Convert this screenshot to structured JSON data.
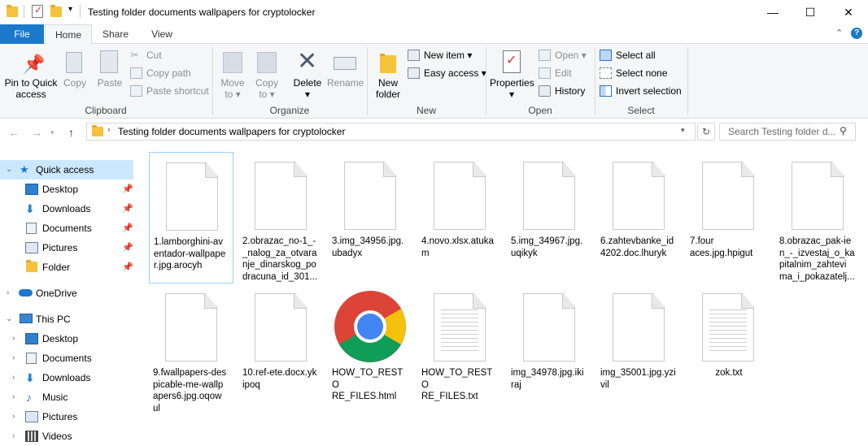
{
  "window": {
    "title": "Testing folder documents  wallpapers for cryptolocker",
    "minimize": "—",
    "maximize": "☐",
    "close": "✕"
  },
  "tabs": {
    "file": "File",
    "home": "Home",
    "share": "Share",
    "view": "View"
  },
  "ribbon": {
    "clipboard": {
      "label": "Clipboard",
      "pin": "Pin to Quick access",
      "pin_line1": "Pin to Quick",
      "pin_line2": "access",
      "copy": "Copy",
      "paste": "Paste",
      "cut": "Cut",
      "copy_path": "Copy path",
      "paste_shortcut": "Paste shortcut"
    },
    "organize": {
      "label": "Organize",
      "move_to": "Move",
      "move_to2": "to ▾",
      "copy_to": "Copy",
      "copy_to2": "to ▾",
      "delete": "Delete",
      "delete2": "▾",
      "rename": "Rename"
    },
    "new": {
      "label": "New",
      "new_folder": "New",
      "new_folder2": "folder",
      "new_item": "New item ▾",
      "easy_access": "Easy access ▾"
    },
    "open": {
      "label": "Open",
      "properties": "Properties",
      "properties2": "▾",
      "open": "Open ▾",
      "edit": "Edit",
      "history": "History"
    },
    "select": {
      "label": "Select",
      "select_all": "Select all",
      "select_none": "Select none",
      "invert": "Invert selection"
    }
  },
  "address": {
    "path": "Testing folder documents  wallpapers for cryptolocker",
    "search_placeholder": "Search Testing folder d..."
  },
  "nav": {
    "quick_access": "Quick access",
    "qa_items": [
      "Desktop",
      "Downloads",
      "Documents",
      "Pictures",
      "Folder"
    ],
    "onedrive": "OneDrive",
    "this_pc": "This PC",
    "pc_items": [
      "Desktop",
      "Documents",
      "Downloads",
      "Music",
      "Pictures",
      "Videos"
    ]
  },
  "files": [
    {
      "name": "1.lamborghini-aventador-wallpaper.jpg.arocyh",
      "icon": "blank-doc"
    },
    {
      "name": "2.obrazac_no-1_-_nalog_za_otvaranje_dinarskog_podracuna_id_301...",
      "icon": "blank-doc"
    },
    {
      "name": "3.img_34956.jpg.ubadyx",
      "icon": "blank-doc"
    },
    {
      "name": "4.novo.xlsx.atukam",
      "icon": "blank-doc"
    },
    {
      "name": "5.img_34967.jpg.uqikyk",
      "icon": "blank-doc"
    },
    {
      "name": "6.zahtevbanke_id4202.doc.lhuryk",
      "icon": "blank-doc"
    },
    {
      "name": "7.four aces.jpg.hpigut",
      "icon": "blank-doc"
    },
    {
      "name": "8.obrazac_pak-ien_-_izvestaj_o_kapitalnim_zahtevima_i_pokazatelj...",
      "icon": "blank-doc"
    },
    {
      "name": "9.fwallpapers-despicable-me-wallpapers6.jpg.oqowul",
      "icon": "blank-doc"
    },
    {
      "name": "10.ref-ete.docx.ykipoq",
      "icon": "blank-doc"
    },
    {
      "name": "HOW_TO_RESTORE_FILES.html",
      "icon": "chrome-icon"
    },
    {
      "name": "HOW_TO_RESTORE_FILES.txt",
      "icon": "text-doc"
    },
    {
      "name": "img_34978.jpg.ikiraj",
      "icon": "blank-doc"
    },
    {
      "name": "img_35001.jpg.yzivil",
      "icon": "blank-doc"
    },
    {
      "name": "zok.txt",
      "icon": "text-doc"
    }
  ],
  "file_display": [
    [
      "1.lamborghini-av",
      "entador-wallpape",
      "r.jpg.arocyh"
    ],
    [
      "2.obrazac_no-1_-",
      "_nalog_za_otvara",
      "nje_dinarskog_po",
      "dracuna_id_301..."
    ],
    [
      "3.img_34956.jpg.",
      "ubadyx"
    ],
    [
      "4.novo.xlsx.atuka",
      "m"
    ],
    [
      "5.img_34967.jpg.",
      "uqikyk"
    ],
    [
      "6.zahtevbanke_id",
      "4202.doc.lhuryk"
    ],
    [
      "7.four",
      "aces.jpg.hpigut"
    ],
    [
      "8.obrazac_pak-ie",
      "n_-_izvestaj_o_ka",
      "pitalnim_zahtevi",
      "ma_i_pokazatelj..."
    ],
    [
      "9.fwallpapers-des",
      "picable-me-wallp",
      "apers6.jpg.oqow",
      "ul"
    ],
    [
      "10.ref-ete.docx.yk",
      "ipoq"
    ],
    [
      "HOW_TO_RESTO",
      "RE_FILES.html"
    ],
    [
      "HOW_TO_RESTO",
      "RE_FILES.txt"
    ],
    [
      "img_34978.jpg.iki",
      "raj"
    ],
    [
      "img_35001.jpg.yzi",
      "vil"
    ],
    [
      "zok.txt"
    ]
  ],
  "colors": {
    "file_tab": "#1979ca",
    "selection": "#cce8ff",
    "accent": "#0078d7"
  }
}
